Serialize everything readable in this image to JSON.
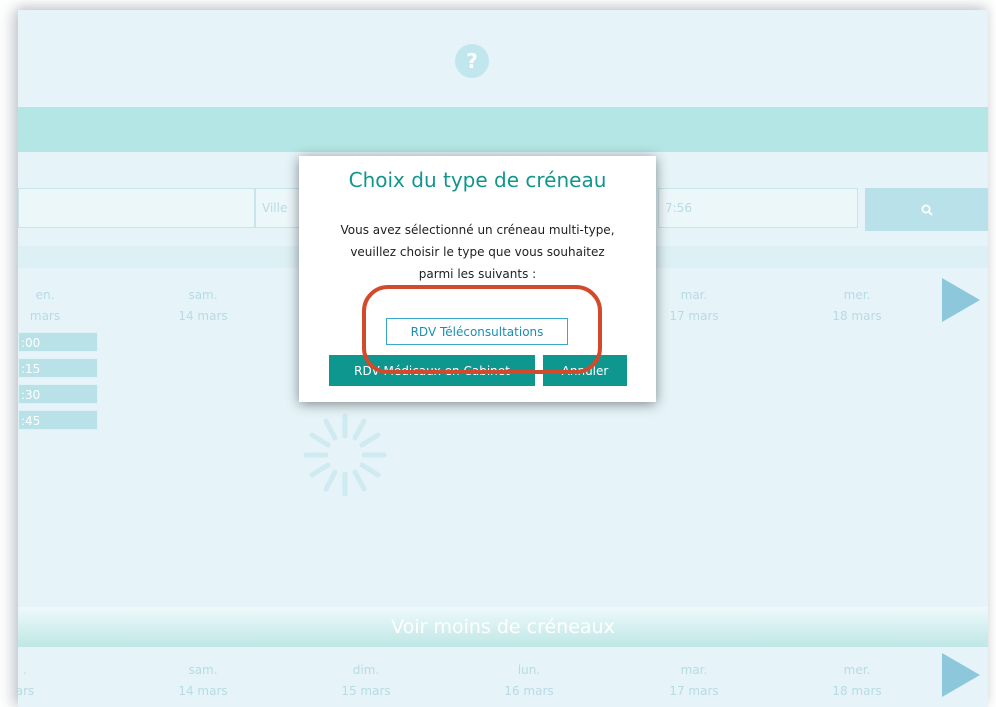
{
  "help_icon": "?",
  "search": {
    "field1_placeholder": "",
    "field2_placeholder": "Ville",
    "field3_value": "7:56",
    "button_icon": "search-icon"
  },
  "days_top": [
    {
      "day": "en.",
      "date": "mars"
    },
    {
      "day": "sam.",
      "date": "14 mars"
    },
    {
      "day": "mar.",
      "date": "17 mars"
    },
    {
      "day": "mer.",
      "date": "18 mars"
    }
  ],
  "slots": [
    ":00",
    ":15",
    ":30",
    ":45"
  ],
  "show_less": "Voir moins de créneaux",
  "days_bottom": [
    {
      "day": ".",
      "date": "ars"
    },
    {
      "day": "sam.",
      "date": "14 mars"
    },
    {
      "day": "dim.",
      "date": "15 mars"
    },
    {
      "day": "lun.",
      "date": "16 mars"
    },
    {
      "day": "mar.",
      "date": "17 mars"
    },
    {
      "day": "mer.",
      "date": "18 mars"
    }
  ],
  "modal": {
    "title": "Choix du type de créneau",
    "line1": "Vous avez sélectionné un créneau multi-type,",
    "line2": "veuillez choisir le type que vous souhaitez",
    "line3": "parmi les suivants :",
    "btn_teleconsult": "RDV Téléconsultations",
    "btn_cabinet": "RDV Médicaux en Cabinet",
    "btn_cancel": "Annuler"
  },
  "colors": {
    "accent": "#0d978f",
    "highlight": "#d24a2b",
    "link_blue": "#1a8fb4"
  }
}
